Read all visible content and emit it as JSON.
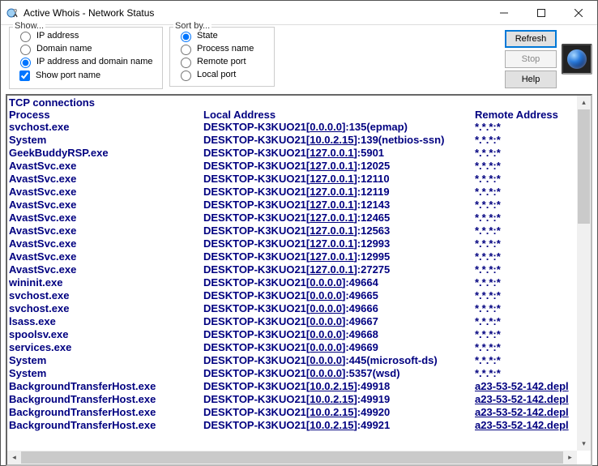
{
  "window": {
    "title": "Active Whois - Network Status"
  },
  "groups": {
    "show": {
      "legend": "Show...",
      "opt_ip": "IP address",
      "opt_domain": "Domain name",
      "opt_both": "IP address and domain name",
      "chk_port": "Show port name",
      "selected": "both",
      "port_checked": true
    },
    "sort": {
      "legend": "Sort by...",
      "opt_state": "State",
      "opt_process": "Process name",
      "opt_rport": "Remote port",
      "opt_lport": "Local port",
      "selected": "state"
    }
  },
  "buttons": {
    "refresh": "Refresh",
    "stop": "Stop",
    "help": "Help"
  },
  "headers": {
    "section": "TCP connections",
    "process": "Process",
    "local": "Local Address",
    "remote": "Remote Address"
  },
  "rows": [
    {
      "process": "svchost.exe",
      "host": "DESKTOP-K3KUO21",
      "ip": "0.0.0.0",
      "port": "135",
      "portname": "epmap",
      "remote": "*.*.*:*"
    },
    {
      "process": "System",
      "host": "DESKTOP-K3KUO21",
      "ip": "10.0.2.15",
      "port": "139",
      "portname": "netbios-ssn",
      "remote": "*.*.*:*"
    },
    {
      "process": "GeekBuddyRSP.exe",
      "host": "DESKTOP-K3KUO21",
      "ip": "127.0.0.1",
      "port": "5901",
      "remote": "*.*.*:*"
    },
    {
      "process": "AvastSvc.exe",
      "host": "DESKTOP-K3KUO21",
      "ip": "127.0.0.1",
      "port": "12025",
      "remote": "*.*.*:*"
    },
    {
      "process": "AvastSvc.exe",
      "host": "DESKTOP-K3KUO21",
      "ip": "127.0.0.1",
      "port": "12110",
      "remote": "*.*.*:*"
    },
    {
      "process": "AvastSvc.exe",
      "host": "DESKTOP-K3KUO21",
      "ip": "127.0.0.1",
      "port": "12119",
      "remote": "*.*.*:*"
    },
    {
      "process": "AvastSvc.exe",
      "host": "DESKTOP-K3KUO21",
      "ip": "127.0.0.1",
      "port": "12143",
      "remote": "*.*.*:*"
    },
    {
      "process": "AvastSvc.exe",
      "host": "DESKTOP-K3KUO21",
      "ip": "127.0.0.1",
      "port": "12465",
      "remote": "*.*.*:*"
    },
    {
      "process": "AvastSvc.exe",
      "host": "DESKTOP-K3KUO21",
      "ip": "127.0.0.1",
      "port": "12563",
      "remote": "*.*.*:*"
    },
    {
      "process": "AvastSvc.exe",
      "host": "DESKTOP-K3KUO21",
      "ip": "127.0.0.1",
      "port": "12993",
      "remote": "*.*.*:*"
    },
    {
      "process": "AvastSvc.exe",
      "host": "DESKTOP-K3KUO21",
      "ip": "127.0.0.1",
      "port": "12995",
      "remote": "*.*.*:*"
    },
    {
      "process": "AvastSvc.exe",
      "host": "DESKTOP-K3KUO21",
      "ip": "127.0.0.1",
      "port": "27275",
      "remote": "*.*.*:*"
    },
    {
      "process": "wininit.exe",
      "host": "DESKTOP-K3KUO21",
      "ip": "0.0.0.0",
      "port": "49664",
      "remote": "*.*.*:*"
    },
    {
      "process": "svchost.exe",
      "host": "DESKTOP-K3KUO21",
      "ip": "0.0.0.0",
      "port": "49665",
      "remote": "*.*.*:*"
    },
    {
      "process": "svchost.exe",
      "host": "DESKTOP-K3KUO21",
      "ip": "0.0.0.0",
      "port": "49666",
      "remote": "*.*.*:*"
    },
    {
      "process": "lsass.exe",
      "host": "DESKTOP-K3KUO21",
      "ip": "0.0.0.0",
      "port": "49667",
      "remote": "*.*.*:*"
    },
    {
      "process": "spoolsv.exe",
      "host": "DESKTOP-K3KUO21",
      "ip": "0.0.0.0",
      "port": "49668",
      "remote": "*.*.*:*"
    },
    {
      "process": "services.exe",
      "host": "DESKTOP-K3KUO21",
      "ip": "0.0.0.0",
      "port": "49669",
      "remote": "*.*.*:*"
    },
    {
      "process": "System",
      "host": "DESKTOP-K3KUO21",
      "ip": "0.0.0.0",
      "port": "445",
      "portname": "microsoft-ds",
      "remote": "*.*.*:*"
    },
    {
      "process": "System",
      "host": "DESKTOP-K3KUO21",
      "ip": "0.0.0.0",
      "port": "5357",
      "portname": "wsd",
      "remote": "*.*.*:*"
    },
    {
      "process": "BackgroundTransferHost.exe",
      "host": "DESKTOP-K3KUO21",
      "ip": "10.0.2.15",
      "port": "49918",
      "remote": "a23-53-52-142.depl",
      "remotelink": true
    },
    {
      "process": "BackgroundTransferHost.exe",
      "host": "DESKTOP-K3KUO21",
      "ip": "10.0.2.15",
      "port": "49919",
      "remote": "a23-53-52-142.depl",
      "remotelink": true
    },
    {
      "process": "BackgroundTransferHost.exe",
      "host": "DESKTOP-K3KUO21",
      "ip": "10.0.2.15",
      "port": "49920",
      "remote": "a23-53-52-142.depl",
      "remotelink": true
    },
    {
      "process": "BackgroundTransferHost.exe",
      "host": "DESKTOP-K3KUO21",
      "ip": "10.0.2.15",
      "port": "49921",
      "remote": "a23-53-52-142.depl",
      "remotelink": true
    }
  ]
}
